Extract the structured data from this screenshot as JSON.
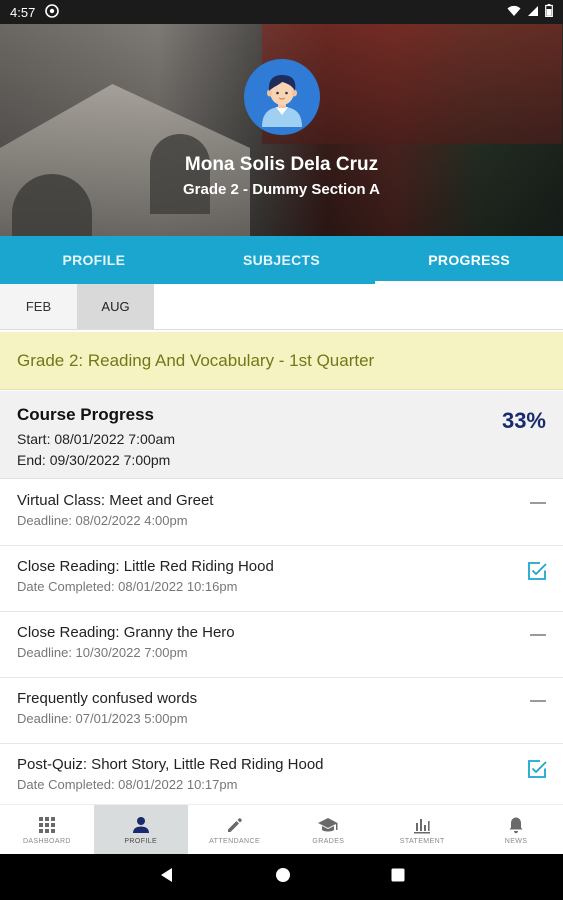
{
  "status_bar": {
    "time": "4:57"
  },
  "header": {
    "student_name": "Mona Solis Dela Cruz",
    "section": "Grade 2 - Dummy Section A"
  },
  "tabs": [
    {
      "label": "PROFILE",
      "active": false
    },
    {
      "label": "SUBJECTS",
      "active": false
    },
    {
      "label": "PROGRESS",
      "active": true
    }
  ],
  "months": [
    {
      "label": "FEB",
      "selected": false
    },
    {
      "label": "AUG",
      "selected": true
    }
  ],
  "subject": {
    "title": "Grade 2: Reading And Vocabulary - 1st Quarter"
  },
  "course_progress": {
    "title": "Course Progress",
    "start": "Start: 08/01/2022 7:00am",
    "end": "End: 09/30/2022 7:00pm",
    "percent": "33%"
  },
  "activities": [
    {
      "title": "Virtual Class: Meet and Greet",
      "meta": "Deadline: 08/02/2022 4:00pm",
      "status": "pending"
    },
    {
      "title": "Close Reading: Little Red Riding Hood",
      "meta": "Date Completed: 08/01/2022 10:16pm",
      "status": "completed"
    },
    {
      "title": "Close Reading: Granny the Hero",
      "meta": "Deadline: 10/30/2022 7:00pm",
      "status": "pending"
    },
    {
      "title": "Frequently confused words",
      "meta": "Deadline: 07/01/2023 5:00pm",
      "status": "pending"
    },
    {
      "title": "Post-Quiz: Short Story, Little Red Riding Hood",
      "meta": "Date Completed: 08/01/2022 10:17pm",
      "status": "completed"
    }
  ],
  "bottom_nav": [
    {
      "label": "DASHBOARD",
      "icon": "grid-icon",
      "active": false
    },
    {
      "label": "PROFILE",
      "icon": "person-icon",
      "active": true
    },
    {
      "label": "ATTENDANCE",
      "icon": "pencil-icon",
      "active": false
    },
    {
      "label": "GRADES",
      "icon": "graduation-cap-icon",
      "active": false
    },
    {
      "label": "STATEMENT",
      "icon": "bar-chart-icon",
      "active": false
    },
    {
      "label": "NEWS",
      "icon": "bell-icon",
      "active": false
    }
  ],
  "colors": {
    "tab_bar": "#1aa6cf",
    "subject_banner": "#f6f3c2",
    "subject_text": "#6f7a16",
    "percent_text": "#1a2b6d",
    "check_color": "#1aa6cf"
  }
}
